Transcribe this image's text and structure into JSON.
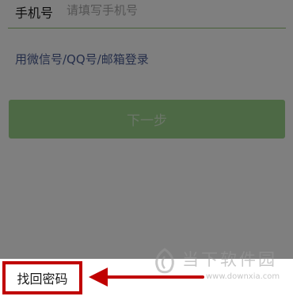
{
  "form": {
    "phone_label": "手机号",
    "phone_placeholder": "请填写手机号",
    "alt_login_link": "用微信号/QQ号/邮箱登录",
    "next_button": "下一步"
  },
  "footer": {
    "find_password": "找回密码"
  },
  "watermark": {
    "site_name": "当下软件园",
    "url": "www.downxia.com"
  },
  "colors": {
    "accent_green": "#9bd28b",
    "annotation_red": "#c00000",
    "link_blue": "#4a5c93"
  }
}
